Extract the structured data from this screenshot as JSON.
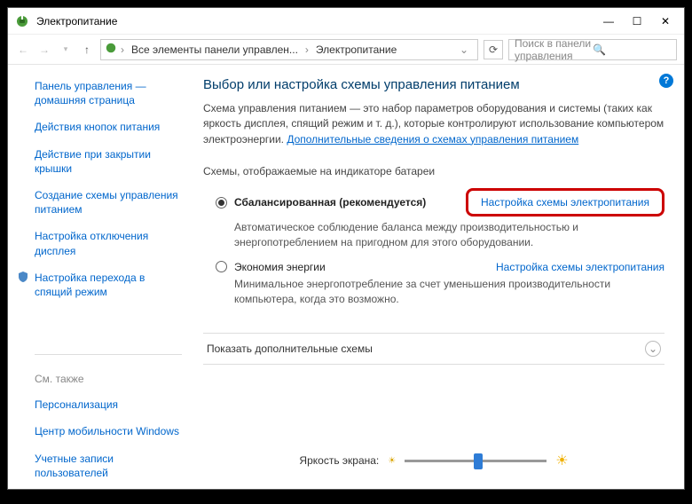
{
  "window": {
    "title": "Электропитание"
  },
  "titlebar_controls": {
    "min": "—",
    "max": "☐",
    "close": "✕"
  },
  "breadcrumb": {
    "crumb1": "Все элементы панели управлен...",
    "crumb2": "Электропитание",
    "search_placeholder": "Поиск в панели управления"
  },
  "help": "?",
  "sidebar": {
    "home": "Панель управления — домашняя страница",
    "links": [
      "Действия кнопок питания",
      "Действие при закрытии крышки",
      "Создание схемы управления питанием",
      "Настройка отключения дисплея",
      "Настройка перехода в спящий режим"
    ],
    "see_also_label": "См. также",
    "see_also": [
      "Персонализация",
      "Центр мобильности Windows",
      "Учетные записи пользователей"
    ]
  },
  "main": {
    "heading": "Выбор или настройка схемы управления питанием",
    "desc_a": "Схема управления питанием — это набор параметров оборудования и системы (таких как яркость дисплея, спящий режим и т. д.), которые контролируют использование компьютером электроэнергии. ",
    "desc_link": "Дополнительные сведения о схемах управления питанием",
    "section": "Схемы, отображаемые на индикаторе батареи",
    "plans": [
      {
        "name": "Сбалансированная (рекомендуется)",
        "selected": true,
        "link": "Настройка схемы электропитания",
        "desc": "Автоматическое соблюдение баланса между производительностью и энергопотреблением на пригодном для этого оборудовании."
      },
      {
        "name": "Экономия энергии",
        "selected": false,
        "link": "Настройка схемы электропитания",
        "desc": "Минимальное энергопотребление за счет уменьшения производительности компьютера, когда это возможно."
      }
    ],
    "expander": "Показать дополнительные схемы",
    "brightness_label": "Яркость экрана:"
  }
}
